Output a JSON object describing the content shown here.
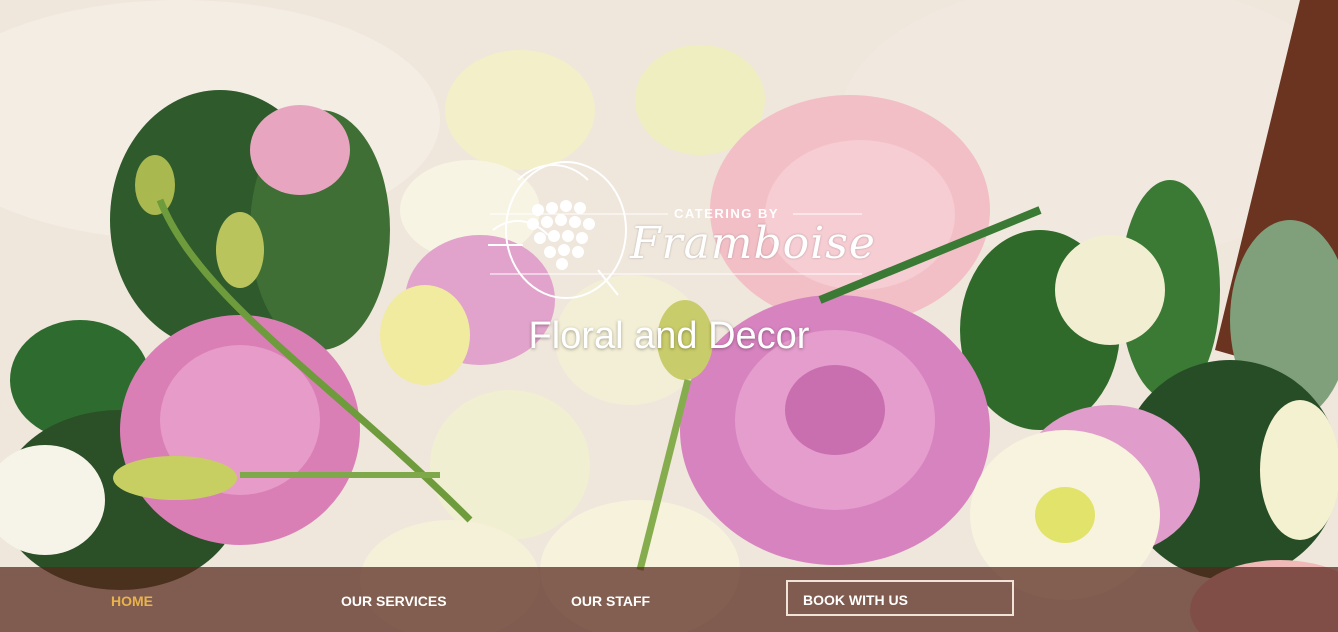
{
  "logo": {
    "caption": "CATERING BY",
    "script": "Framboise"
  },
  "page_title": "Floral and Decor",
  "nav": {
    "items": [
      {
        "label": "HOME",
        "active": true
      },
      {
        "label": "OUR SERVICES",
        "active": false
      },
      {
        "label": "OUR STAFF",
        "active": false
      }
    ],
    "cta_label": "BOOK WITH US"
  },
  "colors": {
    "nav_bg": "#54261a",
    "active": "#e8b44a",
    "text": "#ffffff"
  }
}
